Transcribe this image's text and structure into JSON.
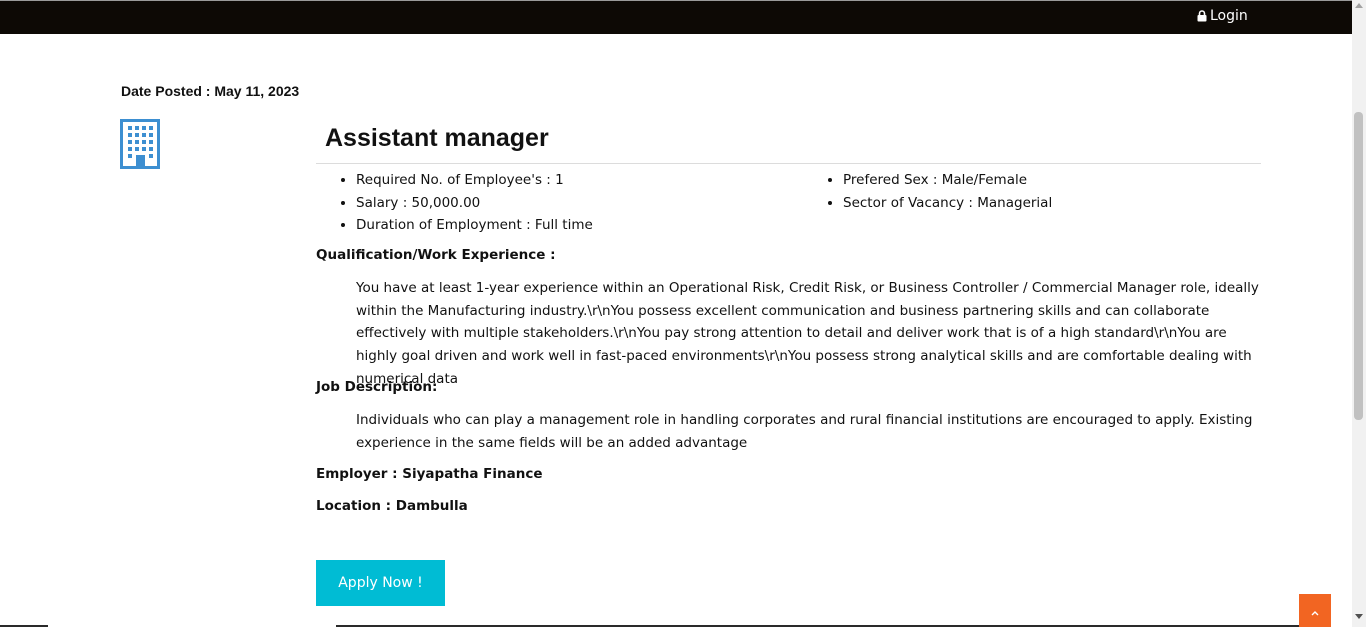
{
  "header": {
    "login_label": "Login",
    "background": "#0d0905",
    "icon": "lock-icon"
  },
  "job": {
    "date_posted": "Date Posted : May 11, 2023",
    "company_icon": "building-icon",
    "title": "Assistant manager",
    "details_left": [
      "Required No. of Employee's : 1",
      "Salary : 50,000.00",
      "Duration of Employment : Full time"
    ],
    "details_right": [
      "Prefered Sex : Male/Female",
      "Sector of Vacancy : Managerial"
    ],
    "qualification_label": "Qualification/Work Experience :",
    "qualification_text": "You have at least 1-year experience within an Operational Risk, Credit Risk, or Business Controller / Commercial Manager role, ideally within the Manufacturing industry.\\r\\nYou possess excellent communication and business partnering skills and can collaborate effectively with multiple stakeholders.\\r\\nYou pay strong attention to detail and deliver work that is of a high standard\\r\\nYou are highly goal driven and work well in fast-paced environments\\r\\nYou possess strong analytical skills and are comfortable dealing with numerical data",
    "description_label": "Job Description:",
    "description_text": "Individuals who can play a management role in handling corporates and rural financial institutions are encouraged to apply. Existing experience in the same fields will be an added advantage",
    "employer": "Employer : Siyapatha Finance",
    "location": "Location : Dambulla",
    "apply_label": "Apply Now !"
  },
  "colors": {
    "accent": "#00bcd4",
    "back_to_top": "#f26522",
    "icon_blue": "#3d8fd1"
  }
}
